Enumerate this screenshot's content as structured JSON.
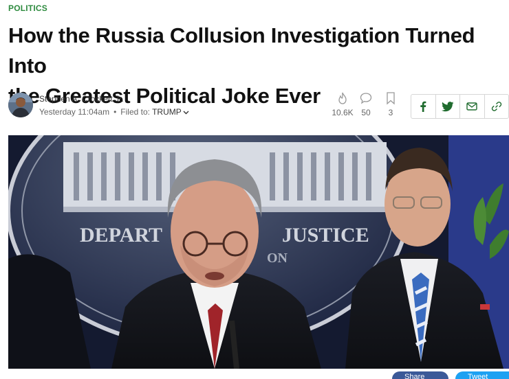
{
  "article": {
    "category": "POLITICS",
    "headline_line1": "How the Russia Collusion Investigation Turned Into",
    "headline_line2": "the Greatest Political Joke Ever",
    "author": "Stephen A. Crockett Jr.",
    "timestamp": "Yesterday 11:04am",
    "filed_prefix": "Filed to:",
    "filed_tag": "TRUMP"
  },
  "stats": {
    "views": "10.6K",
    "comments": "50",
    "saves": "3"
  },
  "share": {
    "buttons": [
      "facebook-icon",
      "twitter-icon",
      "email-icon",
      "link-icon"
    ]
  },
  "hero": {
    "podium_text_left": "DEPART",
    "podium_text_right": "JUSTICE",
    "podium_text_sub": "ON"
  },
  "bottom": {
    "fb_label": "Share",
    "tw_label": "Tweet"
  },
  "colors": {
    "category": "#2e8b3f",
    "share_icons": "#1f6b2e",
    "facebook": "#3b5998",
    "twitter": "#1da1f2"
  }
}
